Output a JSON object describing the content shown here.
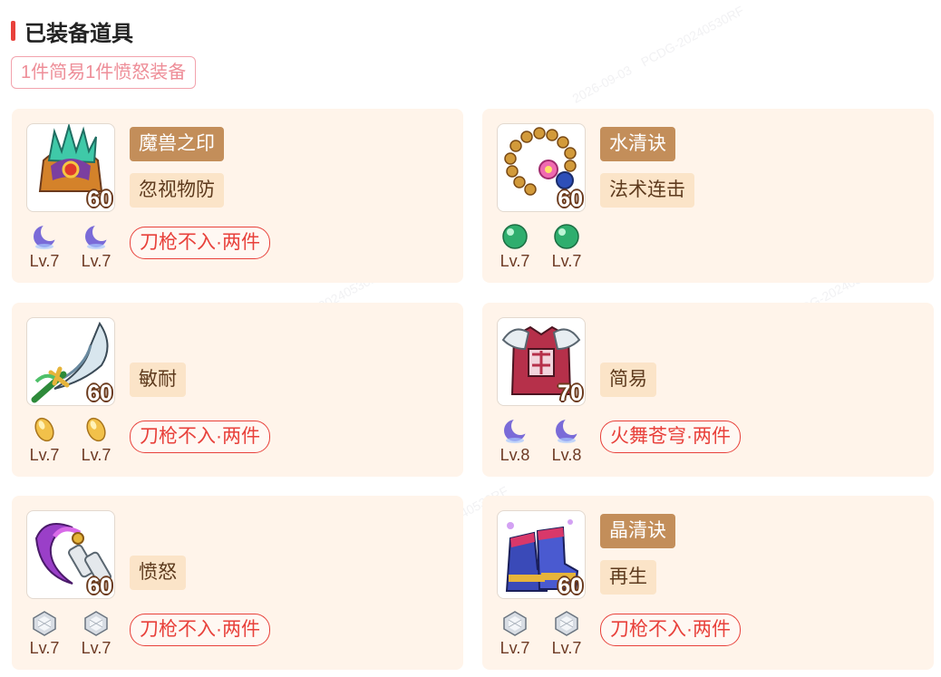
{
  "header": {
    "title": "已装备道具"
  },
  "summary": "1件简易1件愤怒装备",
  "equipment": [
    {
      "icon": "helmet-icon",
      "level": "60",
      "name": "魔兽之印",
      "effect": "忽视物防",
      "gems": [
        {
          "icon": "moon-gem-icon",
          "level": "Lv.7"
        },
        {
          "icon": "moon-gem-icon",
          "level": "Lv.7"
        }
      ],
      "suit": "刀枪不入·两件"
    },
    {
      "icon": "necklace-icon",
      "level": "60",
      "name": "水清诀",
      "effect": "法术连击",
      "gems": [
        {
          "icon": "green-orb-gem-icon",
          "level": "Lv.7"
        },
        {
          "icon": "green-orb-gem-icon",
          "level": "Lv.7"
        }
      ],
      "suit": ""
    },
    {
      "icon": "sword-icon",
      "level": "60",
      "name": "",
      "effect": "敏耐",
      "gems": [
        {
          "icon": "yellow-gem-icon",
          "level": "Lv.7"
        },
        {
          "icon": "yellow-gem-icon",
          "level": "Lv.7"
        }
      ],
      "suit": "刀枪不入·两件"
    },
    {
      "icon": "armor-icon",
      "level": "70",
      "name": "",
      "effect": "简易",
      "gems": [
        {
          "icon": "moon-gem-icon",
          "level": "Lv.8"
        },
        {
          "icon": "moon-gem-icon",
          "level": "Lv.8"
        }
      ],
      "suit": "火舞苍穹·两件"
    },
    {
      "icon": "belt-icon",
      "level": "60",
      "name": "",
      "effect": "愤怒",
      "gems": [
        {
          "icon": "white-gem-icon",
          "level": "Lv.7"
        },
        {
          "icon": "white-gem-icon",
          "level": "Lv.7"
        }
      ],
      "suit": "刀枪不入·两件"
    },
    {
      "icon": "boots-icon",
      "level": "60",
      "name": "晶清诀",
      "effect": "再生",
      "gems": [
        {
          "icon": "white-gem-icon",
          "level": "Lv.7"
        },
        {
          "icon": "white-gem-icon",
          "level": "Lv.7"
        }
      ],
      "suit": "刀枪不入·两件"
    }
  ],
  "colors": {
    "accent": "#e8413b",
    "card_bg": "#fff4ea",
    "tag_brown": "#c38e5a",
    "tag_cream": "#fbe4c8"
  }
}
